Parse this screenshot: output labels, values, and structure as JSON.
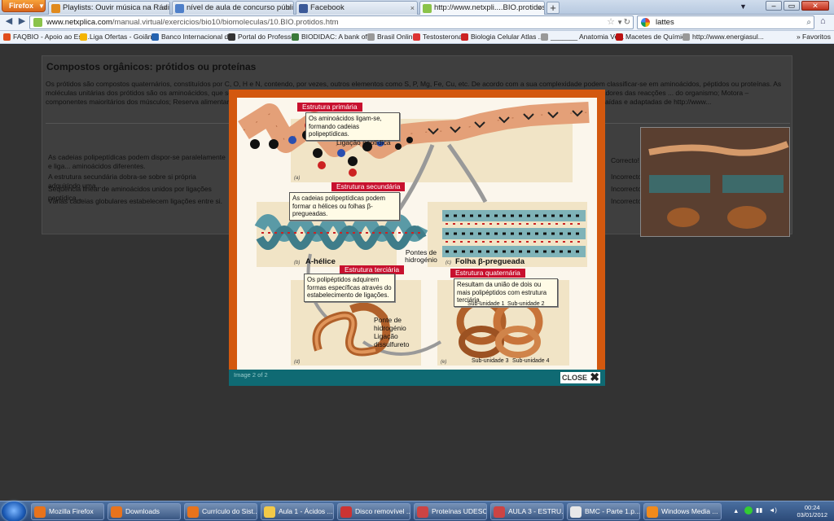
{
  "browser": {
    "menu_button": "Firefox",
    "tabs": [
      {
        "label": "Playlists: Ouvir música na Rádio UOL",
        "color": "#e08a1e"
      },
      {
        "label": "nível de aula de concurso público - P...",
        "color": "#4e7fc9"
      },
      {
        "label": "Facebook",
        "color": "#3b5998"
      },
      {
        "label": "http://www.netxpli....BIO.protidos.htm",
        "color": "#8bc34a"
      }
    ],
    "new_tab": "+",
    "url_host": "www.netxplica.com",
    "url_path": "/manual.virtual/exercicios/bio10/biomoleculas/10.BIO.protidos.htm",
    "search_value": "lattes",
    "bookmarks": [
      {
        "label": "FAQBIO - Apoio ao Est...",
        "color": "#e04e1e"
      },
      {
        "label": "Liga Ofertas - Goiânia",
        "color": "#f4b400"
      },
      {
        "label": "Banco Internacional d...",
        "color": "#2563b0"
      },
      {
        "label": "Portal do Professor",
        "color": "#333"
      },
      {
        "label": "BIODIDAC: A bank of ...",
        "color": "#3a7a3a"
      },
      {
        "label": "Brasil Online",
        "color": "#999"
      },
      {
        "label": "Testosterona",
        "color": "#d33"
      },
      {
        "label": "Biologia Celular Atlas ...",
        "color": "#c22"
      },
      {
        "label": "_______ Anatomia Ve...",
        "color": "#999"
      },
      {
        "label": "Macetes de Química",
        "color": "#b11"
      },
      {
        "label": "http://www.energiasul...",
        "color": "#999"
      }
    ],
    "favorites": "Favoritos"
  },
  "page": {
    "title": "Compostos orgânicos: prótidos ou proteínas",
    "intro": "Os prótidos são compostos quaternários, constituídos por C, O, H e N, contendo, por vezes, outros elementos como S, P, Mg, Fe, Cu, etc. De acordo com a sua complexidade podem classificar-se em aminoácidos, péptidos ou proteínas. As moléculas unitárias dos prótidos são os aminoácidos, que se ligam através ... biológica das proteínas: Estrutural – Fazem parte de todos os tecidos celulares; Enzimática – biocatalisadores das reacções ... do organismo; Motora – componentes maioritários dos músculos; Reserva alimentar – fornecem aminoácidos. As prot ... estabelece a correspondência entre as afirmações e os termos da chave. Figuras extraídas e adaptadas de http://www...",
    "statements": [
      {
        "text": "As cadeias polipeptídicas podem dispor-se paralelamente e liga... aminoácidos diferentes.",
        "answer": "Correcto!"
      },
      {
        "text": "A estrutura secundária dobra-se sobre si própria adquirindo uma...",
        "answer": "Incorrecto"
      },
      {
        "text": "Sequência linear de aminoácidos unidos por ligações peptídica...",
        "answer": "Incorrecto"
      },
      {
        "text": "Várias cadeias globulares estabelecem ligações entre si.",
        "answer": "Incorrecto"
      }
    ]
  },
  "lightbox": {
    "caption": "Image 2 of 2",
    "close_label": "CLOSE",
    "figure": {
      "primary_title": "Estrutura primária",
      "primary_note": "Os aminoácidos ligam-se, formando cadeias polipeptídicas.",
      "peptide_bond": "Ligação peptídica",
      "secondary_title": "Estrutura secundária",
      "secondary_note": "As cadeias polipeptídicas podem formar α hélices ou folhas β-pregueadas.",
      "alpha": "A-hélice",
      "hbonds": "Pontes de hidrogénio",
      "beta": "Folha β-pregueada",
      "tertiary_title": "Estrutura terciária",
      "tertiary_note": "Os polipéptidos adquirem formas específicas através do estabelecimento de ligações.",
      "tertiary_labels": "Ponte de hidrogénio Ligação dissulfureto",
      "quaternary_title": "Estrutura quaternária",
      "quaternary_note": "Resultam da união de dois ou mais polipéptidos com estrutura terciária.",
      "su1": "Sub-unidade 1",
      "su2": "Sub-unidade 2",
      "su3": "Sub-unidade 3",
      "su4": "Sub-unidade 4",
      "letters": [
        "(a)",
        "(b)",
        "(c)",
        "(d)",
        "(e)"
      ]
    }
  },
  "taskbar": {
    "items": [
      {
        "label": "Mozilla Firefox",
        "color": "#e8731c"
      },
      {
        "label": "Downloads",
        "color": "#e8731c"
      },
      {
        "label": "Currículo do Sist...",
        "color": "#e8731c"
      },
      {
        "label": "Aula 1 - Ácidos ...",
        "color": "#f3c948"
      },
      {
        "label": "Disco removível ...",
        "color": "#c33"
      },
      {
        "label": "Proteínas UDESC",
        "color": "#c44"
      },
      {
        "label": "AULA 3 - ESTRU...",
        "color": "#c44"
      },
      {
        "label": "BMC - Parte 1.p...",
        "color": "#e8e8e8"
      },
      {
        "label": "Windows Media ...",
        "color": "#f08a1c"
      }
    ],
    "time": "00:24",
    "date": "03/01/2012"
  }
}
